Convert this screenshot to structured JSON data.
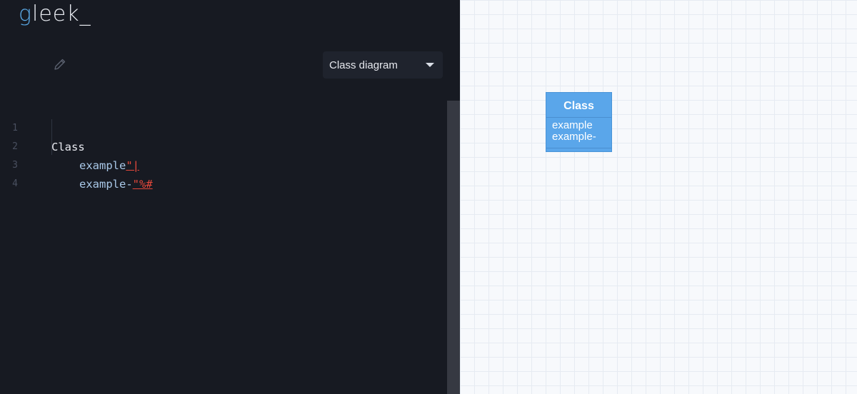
{
  "app": {
    "logo_prefix": "g",
    "logo_rest": "leek_"
  },
  "toolbar": {
    "diagram_type": "Class diagram"
  },
  "editor": {
    "lines": [
      {
        "number": "1",
        "text": "Class"
      },
      {
        "number": "2",
        "text": "example",
        "error": "\"|"
      },
      {
        "number": "3",
        "text": "example-",
        "error": "\"%#"
      },
      {
        "number": "4",
        "text": ""
      }
    ]
  },
  "diagram": {
    "class_name": "Class",
    "attributes": [
      "example",
      "example-"
    ]
  },
  "colors": {
    "editor_bg": "#171a22",
    "accent": "#5aa9e6",
    "error": "#e5483b",
    "class_box": "#5aa6ea"
  }
}
